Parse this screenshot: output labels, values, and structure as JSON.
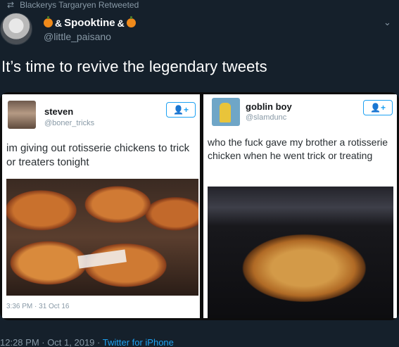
{
  "retweet": {
    "icon": "retweet-icon",
    "text": "Blackerys Targaryen Retweeted"
  },
  "author": {
    "display_name": "Spooktine",
    "handle": "@little_paisano",
    "name_glyph": "&"
  },
  "tweet": {
    "text": "It’s time to revive the legendary tweets"
  },
  "left_card": {
    "name": "steven",
    "handle": "@boner_tricks",
    "follow_label": "+",
    "text": "im giving out rotisserie chickens to trick or treaters tonight",
    "timestamp": "3:36 PM · 31 Oct 16"
  },
  "right_card": {
    "name": "goblin boy",
    "handle": "@slamdunc",
    "follow_label": "+",
    "text": "who the fuck gave my brother a rotisserie chicken when he went trick or treating"
  },
  "footer": {
    "timestamp": "12:28 PM · Oct 1, 2019 · ",
    "source": "Twitter for iPhone"
  },
  "colors": {
    "background": "#15202b",
    "secondary_text": "#8899a6",
    "accent": "#1da1f2"
  }
}
